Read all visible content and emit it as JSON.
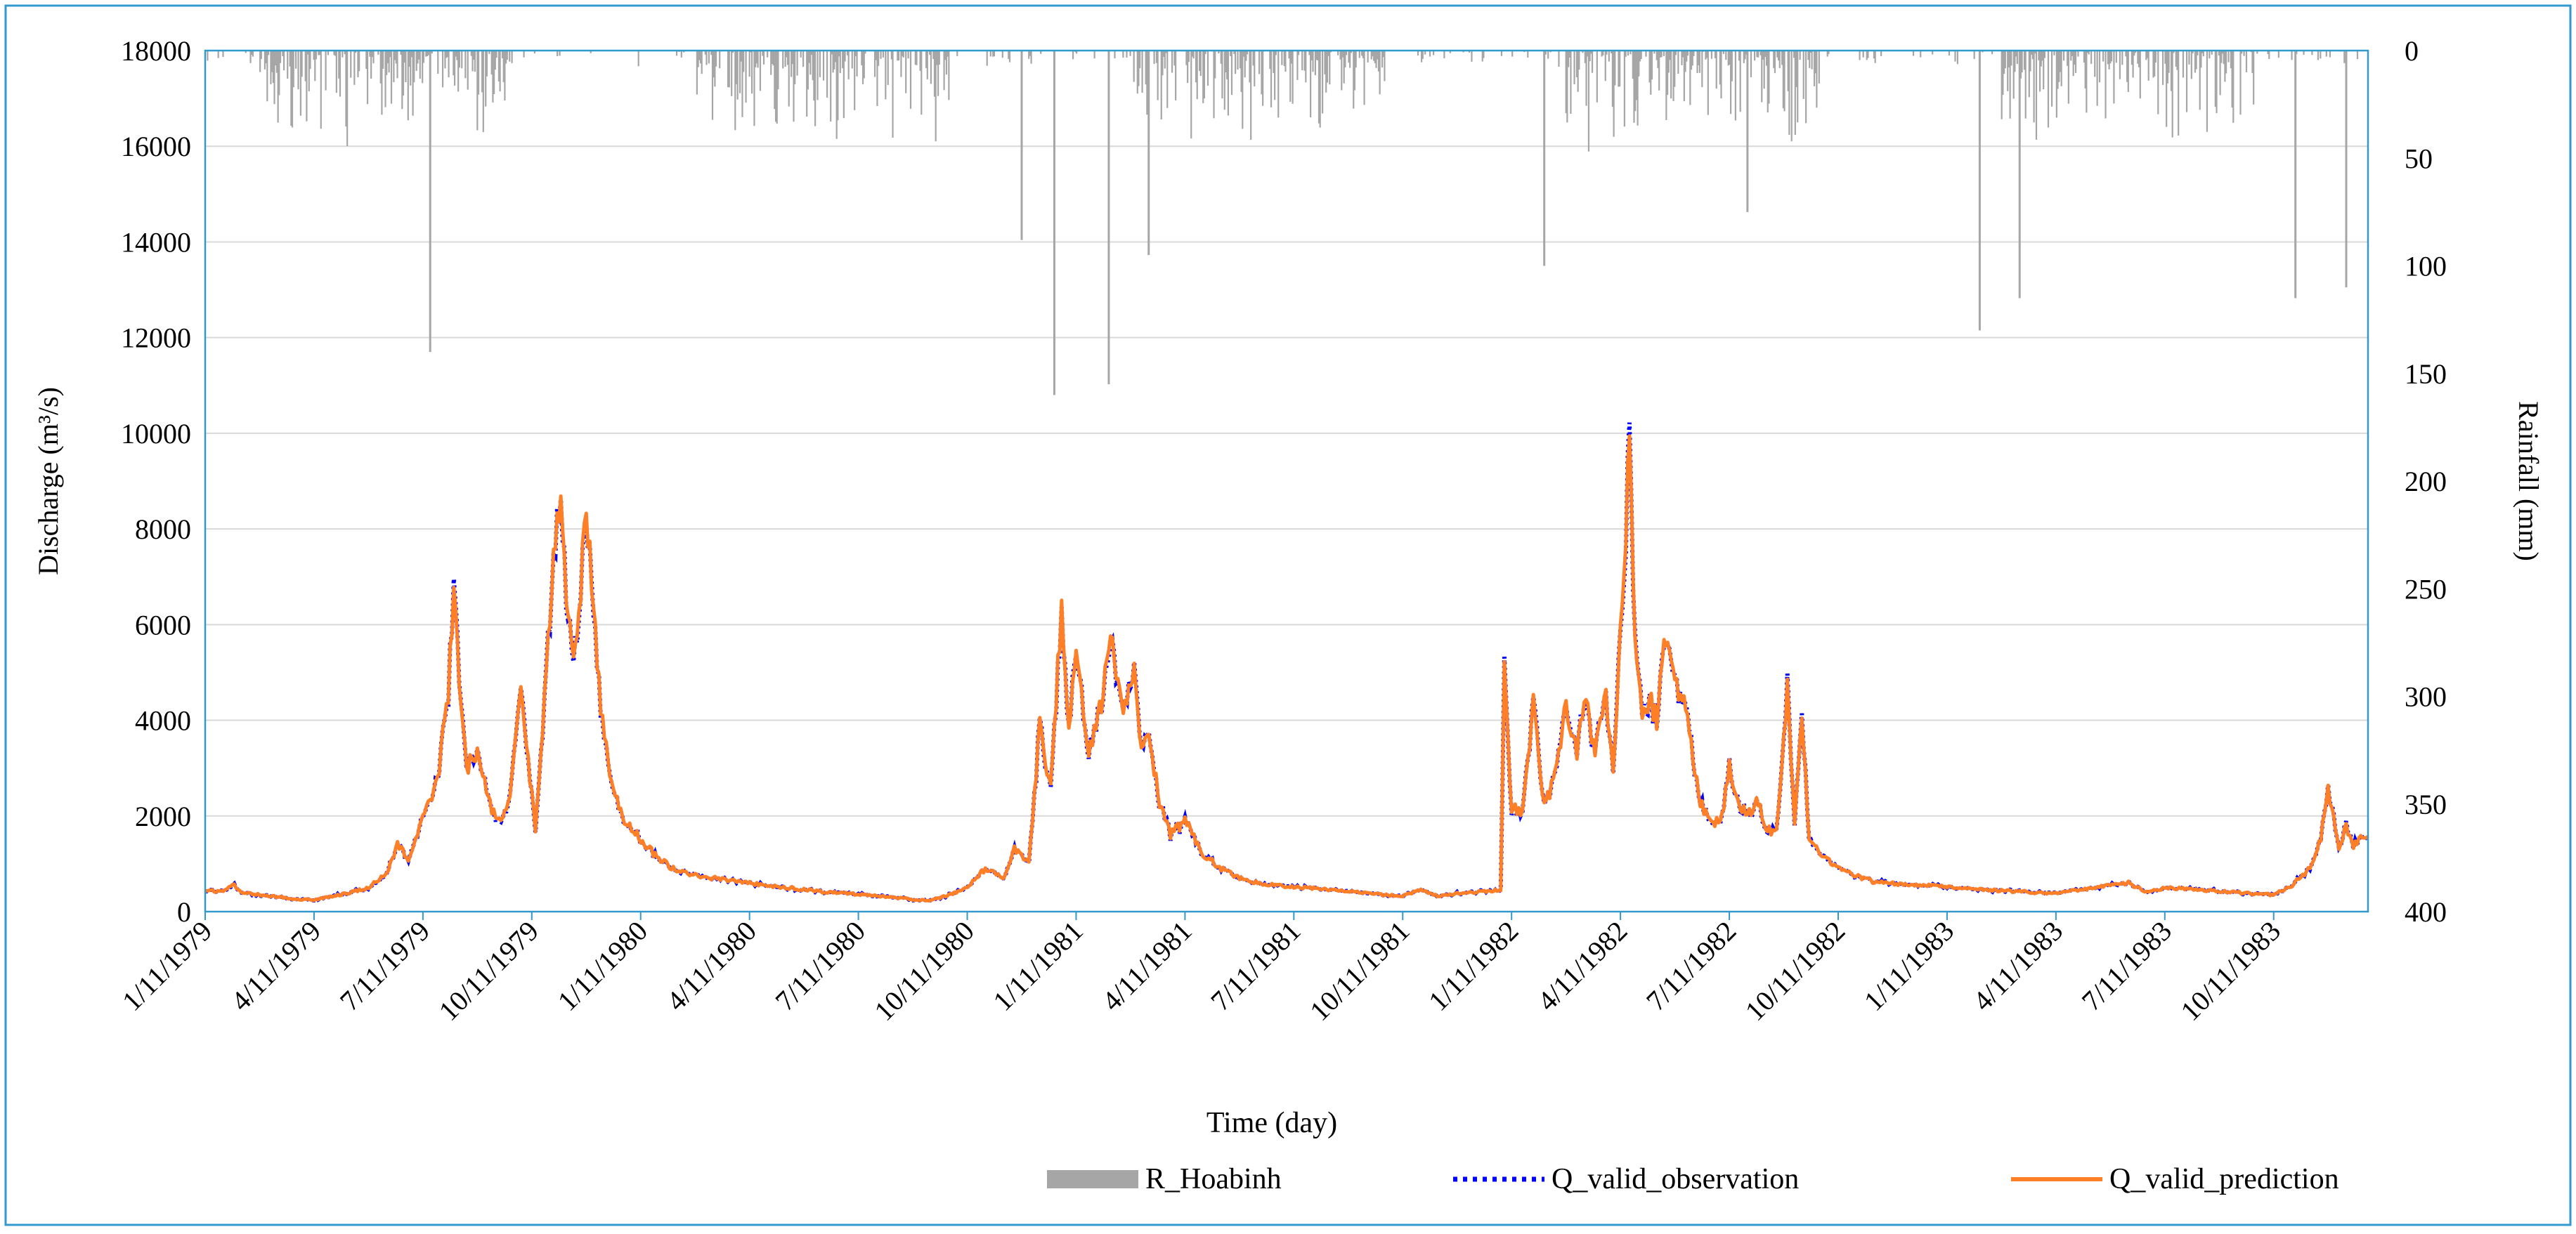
{
  "chart_data": {
    "type": "line",
    "title": "",
    "xlabel": "Time  (day)",
    "ylabel_left": "Discharge  (m³/s)",
    "ylabel_right": "Rainfall  (mm)",
    "x_ticks": [
      "1/11/1979",
      "4/11/1979",
      "7/11/1979",
      "10/11/1979",
      "1/11/1980",
      "4/11/1980",
      "7/11/1980",
      "10/11/1980",
      "1/11/1981",
      "4/11/1981",
      "7/11/1981",
      "10/11/1981",
      "1/11/1982",
      "4/11/1982",
      "7/11/1982",
      "10/11/1982",
      "1/11/1983",
      "4/11/1983",
      "7/11/1983",
      "10/11/1983"
    ],
    "x_range_months": [
      0,
      59.6
    ],
    "y_left": {
      "min": 0,
      "max": 18000,
      "ticks": [
        0,
        2000,
        4000,
        6000,
        8000,
        10000,
        12000,
        14000,
        16000,
        18000
      ]
    },
    "y_right": {
      "min": 0,
      "max": 400,
      "inverted": true,
      "ticks": [
        0,
        50,
        100,
        150,
        200,
        250,
        300,
        350,
        400
      ]
    },
    "grid": "horizontal",
    "legend_position": "bottom",
    "colors": {
      "rain": "#a6a6a6",
      "observation": "#0000ff",
      "prediction": "#ff7f27",
      "frame": "#3399cc",
      "grid": "#d9d9d9"
    },
    "legend": [
      {
        "label": "R_Hoabinh",
        "style": "bar"
      },
      {
        "label": "Q_valid_observation",
        "style": "dotted"
      },
      {
        "label": "Q_valid_prediction",
        "style": "solid"
      }
    ],
    "discharge_anchor_points": [
      [
        0,
        450
      ],
      [
        0.5,
        420
      ],
      [
        0.8,
        560
      ],
      [
        1,
        400
      ],
      [
        2,
        310
      ],
      [
        2.5,
        260
      ],
      [
        3,
        240
      ],
      [
        3.5,
        320
      ],
      [
        4,
        400
      ],
      [
        4.5,
        500
      ],
      [
        5,
        800
      ],
      [
        5.3,
        1400
      ],
      [
        5.6,
        1100
      ],
      [
        6,
        2000
      ],
      [
        6.4,
        2700
      ],
      [
        6.7,
        4600
      ],
      [
        6.85,
        6700
      ],
      [
        7,
        4800
      ],
      [
        7.2,
        3000
      ],
      [
        7.5,
        3400
      ],
      [
        7.8,
        2300
      ],
      [
        8.1,
        1900
      ],
      [
        8.4,
        2300
      ],
      [
        8.7,
        4800
      ],
      [
        8.9,
        3200
      ],
      [
        9.1,
        1700
      ],
      [
        9.3,
        3800
      ],
      [
        9.6,
        7500
      ],
      [
        9.8,
        8900
      ],
      [
        10,
        5900
      ],
      [
        10.2,
        5500
      ],
      [
        10.5,
        8200
      ],
      [
        10.7,
        6500
      ],
      [
        10.9,
        4200
      ],
      [
        11.2,
        2700
      ],
      [
        11.5,
        2000
      ],
      [
        12,
        1500
      ],
      [
        12.5,
        1100
      ],
      [
        13,
        850
      ],
      [
        14,
        700
      ],
      [
        15,
        600
      ],
      [
        16,
        500
      ],
      [
        17,
        420
      ],
      [
        18,
        360
      ],
      [
        19,
        300
      ],
      [
        19.5,
        250
      ],
      [
        20,
        230
      ],
      [
        20.5,
        350
      ],
      [
        21,
        500
      ],
      [
        21.5,
        900
      ],
      [
        22,
        700
      ],
      [
        22.3,
        1300
      ],
      [
        22.7,
        1000
      ],
      [
        23,
        3900
      ],
      [
        23.3,
        2600
      ],
      [
        23.6,
        6300
      ],
      [
        23.8,
        3900
      ],
      [
        24,
        5800
      ],
      [
        24.3,
        3300
      ],
      [
        24.6,
        4000
      ],
      [
        25,
        5700
      ],
      [
        25.3,
        4000
      ],
      [
        25.6,
        5200
      ],
      [
        25.8,
        3300
      ],
      [
        26,
        3600
      ],
      [
        26.3,
        2300
      ],
      [
        26.6,
        1600
      ],
      [
        27,
        1900
      ],
      [
        27.5,
        1200
      ],
      [
        28,
        900
      ],
      [
        28.5,
        700
      ],
      [
        29,
        600
      ],
      [
        29.5,
        550
      ],
      [
        30,
        520
      ],
      [
        31,
        450
      ],
      [
        32,
        400
      ],
      [
        32.5,
        350
      ],
      [
        33,
        330
      ],
      [
        33.5,
        450
      ],
      [
        34,
        320
      ],
      [
        34.5,
        380
      ],
      [
        35.7,
        450
      ],
      [
        35.8,
        5100
      ],
      [
        36,
        2200
      ],
      [
        36.3,
        2000
      ],
      [
        36.6,
        4400
      ],
      [
        36.9,
        2200
      ],
      [
        37.2,
        2800
      ],
      [
        37.5,
        4400
      ],
      [
        37.8,
        3200
      ],
      [
        38,
        4600
      ],
      [
        38.3,
        3300
      ],
      [
        38.6,
        4500
      ],
      [
        38.8,
        3100
      ],
      [
        39,
        5700
      ],
      [
        39.25,
        9800
      ],
      [
        39.4,
        5500
      ],
      [
        39.6,
        4200
      ],
      [
        39.8,
        4500
      ],
      [
        40,
        4000
      ],
      [
        40.2,
        6000
      ],
      [
        40.5,
        4700
      ],
      [
        40.8,
        4400
      ],
      [
        41,
        3100
      ],
      [
        41.2,
        2300
      ],
      [
        41.5,
        1800
      ],
      [
        41.8,
        2000
      ],
      [
        42,
        3100
      ],
      [
        42.2,
        2400
      ],
      [
        42.5,
        2000
      ],
      [
        42.8,
        2300
      ],
      [
        43,
        1700
      ],
      [
        43.3,
        1700
      ],
      [
        43.6,
        4600
      ],
      [
        43.8,
        1800
      ],
      [
        44,
        4200
      ],
      [
        44.2,
        1500
      ],
      [
        44.5,
        1200
      ],
      [
        45,
        900
      ],
      [
        45.5,
        750
      ],
      [
        46,
        620
      ],
      [
        47,
        560
      ],
      [
        48,
        520
      ],
      [
        49,
        460
      ],
      [
        50,
        420
      ],
      [
        51,
        380
      ],
      [
        52,
        500
      ],
      [
        53,
        600
      ],
      [
        53.5,
        400
      ],
      [
        54,
        500
      ],
      [
        55,
        450
      ],
      [
        56,
        400
      ],
      [
        57,
        350
      ],
      [
        57.5,
        550
      ],
      [
        58,
        900
      ],
      [
        58.3,
        1500
      ],
      [
        58.5,
        2600
      ],
      [
        58.8,
        1300
      ],
      [
        59,
        1800
      ],
      [
        59.2,
        1400
      ],
      [
        59.6,
        1600
      ]
    ],
    "note_series": "Q_valid_observation and Q_valid_prediction follow nearly identical daily hydrographs (1979-1983)"
  }
}
